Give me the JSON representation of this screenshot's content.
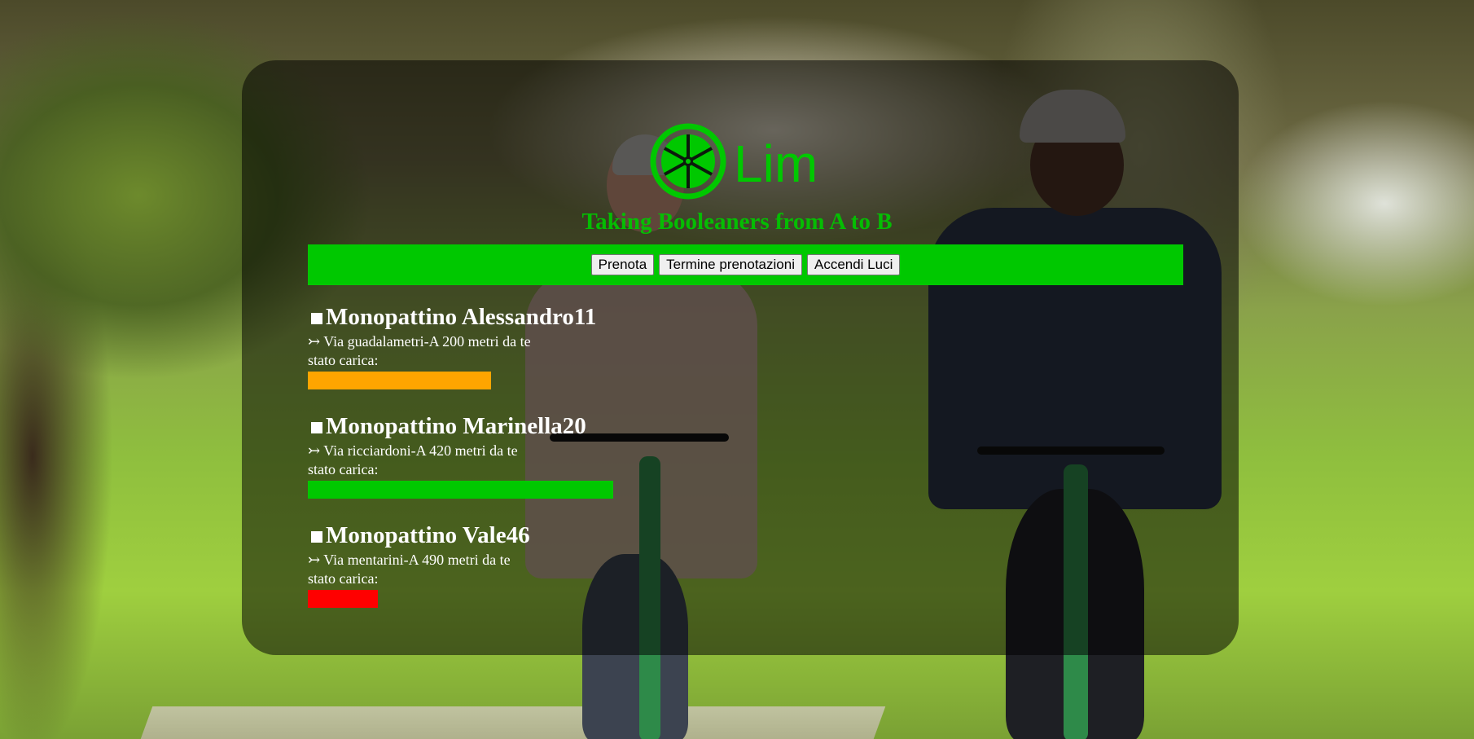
{
  "brand": {
    "logo_text": "Lim",
    "tagline": "Taking Booleaners from A to B",
    "color": "#00c800"
  },
  "nav": {
    "buttons": [
      {
        "label": "Prenota"
      },
      {
        "label": "Termine prenotazioni"
      },
      {
        "label": "Accendi Luci"
      }
    ]
  },
  "scooters": [
    {
      "name": "Monopattino Alessandro11",
      "location": "↣ Via guadalametri-A 200 metri da te",
      "charge_label": "stato carica:",
      "charge_fraction": 0.6,
      "charge_color": "#ffa500"
    },
    {
      "name": "Monopattino Marinella20",
      "location": "↣ Via ricciardoni-A 420 metri da te",
      "charge_label": "stato carica:",
      "charge_fraction": 1.0,
      "charge_color": "#00c800"
    },
    {
      "name": "Monopattino Vale46",
      "location": "↣ Via mentarini-A 490 metri da te",
      "charge_label": "stato carica:",
      "charge_fraction": 0.23,
      "charge_color": "#ff0000"
    }
  ]
}
